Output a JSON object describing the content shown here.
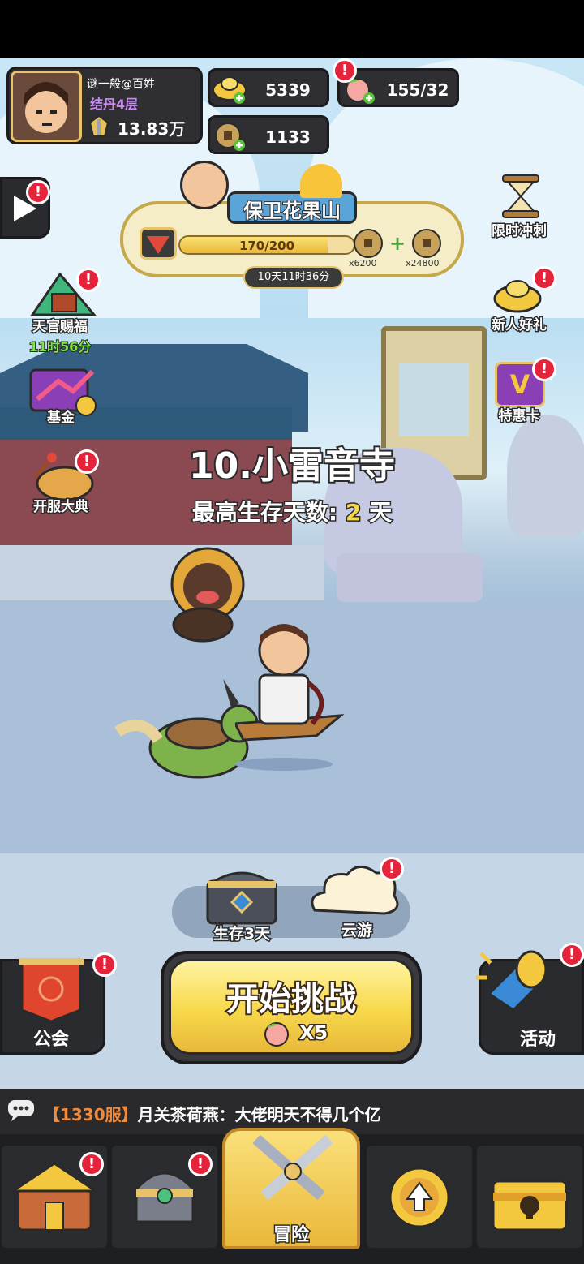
{
  "player": {
    "name": "谜一般@百姓",
    "realm": "结丹4层",
    "power": "13.83万"
  },
  "currencies": {
    "gold": "5339",
    "peach": "155/32",
    "coin": "1133"
  },
  "event": {
    "title": "保卫花果山",
    "progress_text": "170/200",
    "progress": 0.85,
    "reward_1": "x6200",
    "reward_2": "x24800",
    "timer": "10天11时36分"
  },
  "left_menu": {
    "tianguan": "天官赐福",
    "tianguan_timer": "11时56分",
    "fund": "基金",
    "opening": "开服大典"
  },
  "right_menu": {
    "sprint": "限时冲刺",
    "newbie": "新人好礼",
    "card": "特惠卡",
    "card_letter": "V"
  },
  "stage": {
    "title": "10.小雷音寺",
    "best_label": "最高生存天数:",
    "best_value": "2",
    "best_unit": "天"
  },
  "actions": {
    "chest": "生存3天",
    "cloud": "云游",
    "start": "开始挑战",
    "cost": "X5",
    "guild": "公会",
    "activity": "活动"
  },
  "chat": {
    "server": "【1330服】",
    "message": "月关茶荷燕：大佬明天不得几个亿"
  },
  "nav": {
    "adventure": "冒险"
  },
  "badge_mark": "!",
  "colors": {
    "accent_yellow": "#f7d84a",
    "badge_red": "#e5243b",
    "realm_purple": "#c98af5",
    "chat_orange": "#f08a3a"
  }
}
